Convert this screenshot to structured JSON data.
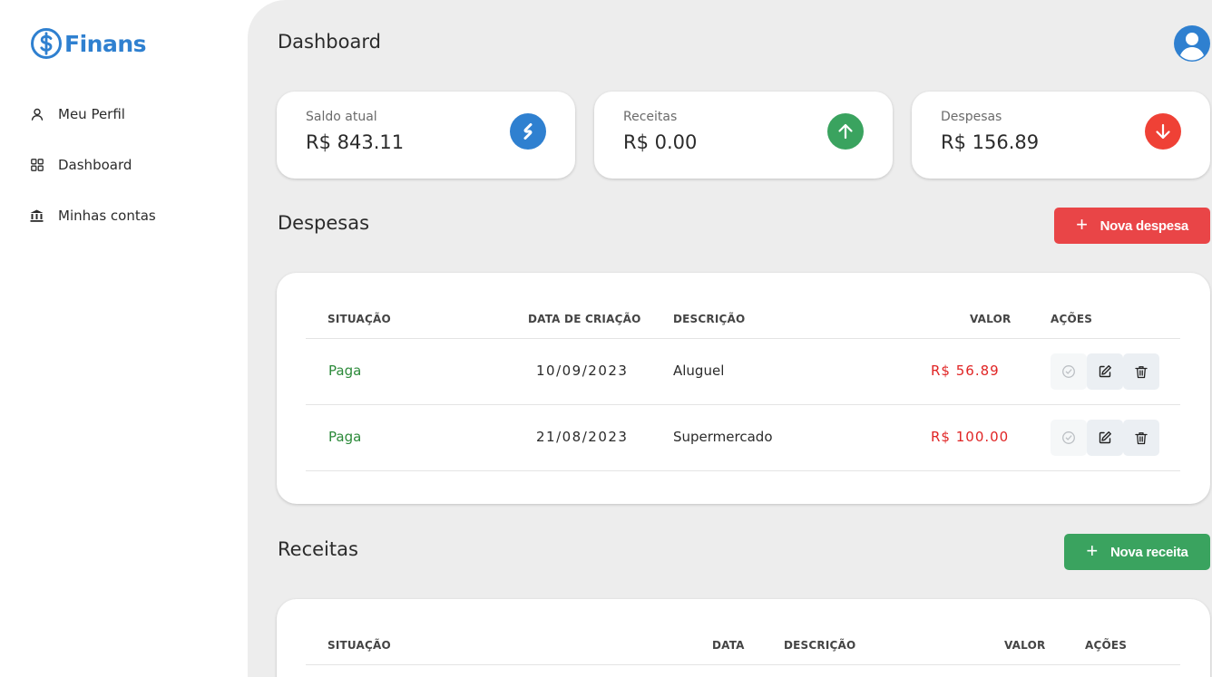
{
  "app": {
    "name": "Finans",
    "brand_color": "#2f80d0"
  },
  "sidebar": {
    "items": [
      {
        "label": "Meu Perfil",
        "icon": "user-icon"
      },
      {
        "label": "Dashboard",
        "icon": "grid-icon"
      },
      {
        "label": "Minhas contas",
        "icon": "bank-icon"
      }
    ]
  },
  "header": {
    "title": "Dashboard",
    "avatar_icon": "user-avatar-icon"
  },
  "cards": [
    {
      "label": "Saldo atual",
      "value": "R$ 843.11",
      "icon": "balance-icon",
      "color": "#2f80d0"
    },
    {
      "label": "Receitas",
      "value": "R$ 0.00",
      "icon": "arrow-up-icon",
      "color": "#3aa35f"
    },
    {
      "label": "Despesas",
      "value": "R$ 156.89",
      "icon": "arrow-down-icon",
      "color": "#ef4136"
    }
  ],
  "despesas": {
    "title": "Despesas",
    "button_label": "Nova despesa",
    "columns": [
      "SITUAÇÃO",
      "DATA DE CRIAÇÃO",
      "DESCRIÇÃO",
      "VALOR",
      "AÇÕES"
    ],
    "rows": [
      {
        "status": "Paga",
        "date": "10/09/2023",
        "description": "Aluguel",
        "value": "R$ 56.89"
      },
      {
        "status": "Paga",
        "date": "21/08/2023",
        "description": "Supermercado",
        "value": "R$ 100.00"
      }
    ]
  },
  "receitas": {
    "title": "Receitas",
    "button_label": "Nova receita",
    "columns": [
      "SITUAÇÃO",
      "DATA",
      "DESCRIÇÃO",
      "VALOR",
      "AÇÕES"
    ]
  },
  "colors": {
    "expense_red": "#e94547",
    "income_green": "#3aa35f",
    "paid_green": "#2c8a3a",
    "value_red": "#e02424"
  }
}
